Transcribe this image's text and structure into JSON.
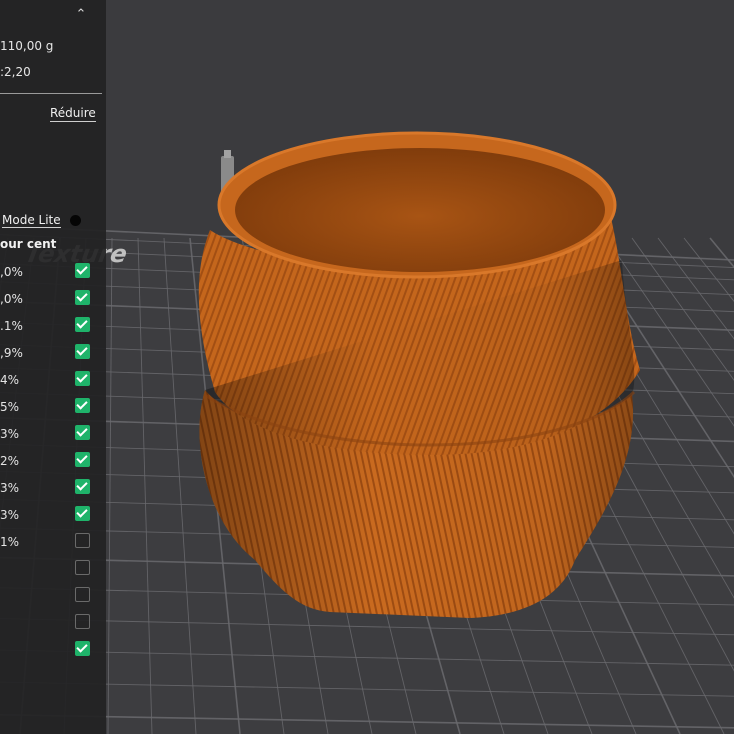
{
  "stats": {
    "weight": "110,00 g",
    "ratio": ":2,20"
  },
  "reduce_label": "Réduire",
  "mode_lite_label": "Mode Lite",
  "column_header": "our cent",
  "plate_text": "Texture",
  "rows": [
    {
      "pct": ",0%",
      "checked": true
    },
    {
      "pct": ",0%",
      "checked": true
    },
    {
      "pct": ".1%",
      "checked": true
    },
    {
      "pct": ",9%",
      "checked": true
    },
    {
      "pct": "4%",
      "checked": true
    },
    {
      "pct": "5%",
      "checked": true
    },
    {
      "pct": "3%",
      "checked": true
    },
    {
      "pct": "2%",
      "checked": true
    },
    {
      "pct": "3%",
      "checked": true
    },
    {
      "pct": "3%",
      "checked": true
    },
    {
      "pct": "1%",
      "checked": false
    },
    {
      "pct": "",
      "checked": false
    },
    {
      "pct": "",
      "checked": false
    },
    {
      "pct": "",
      "checked": false
    },
    {
      "pct": "",
      "checked": true
    }
  ],
  "colors": {
    "model": "#c0631a",
    "model_dark": "#7a3a0c",
    "bed": "#3a3a3d",
    "grid": "#6a6a6e",
    "checkbox_on": "#1fb36a"
  }
}
